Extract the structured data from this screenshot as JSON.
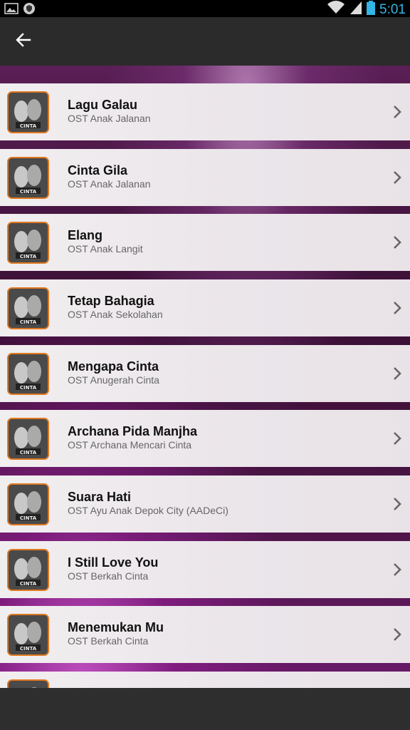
{
  "status_bar": {
    "time": "5:01",
    "left_icons": [
      "image-icon",
      "shield-icon"
    ],
    "right_icons": [
      "wifi-icon",
      "signal-icon",
      "battery-icon"
    ]
  },
  "app_bar": {
    "back_icon": "arrow-left-icon"
  },
  "colors": {
    "accent_time": "#33b5e5",
    "thumb_border": "#e07820",
    "item_bg": "#efebee"
  },
  "songs": [
    {
      "title": "Lagu Galau",
      "subtitle": "OST Anak Jalanan"
    },
    {
      "title": "Cinta Gila",
      "subtitle": "OST Anak Jalanan"
    },
    {
      "title": "Elang",
      "subtitle": "OST Anak Langit"
    },
    {
      "title": "Tetap Bahagia",
      "subtitle": "OST Anak Sekolahan"
    },
    {
      "title": "Mengapa Cinta",
      "subtitle": "OST Anugerah Cinta"
    },
    {
      "title": "Archana Pida Manjha",
      "subtitle": "OST Archana Mencari Cinta"
    },
    {
      "title": "Suara Hati",
      "subtitle": "OST Ayu Anak Depok City (AADeCi)"
    },
    {
      "title": "I Still Love You",
      "subtitle": "OST Berkah Cinta"
    },
    {
      "title": "Menemukan Mu",
      "subtitle": "OST Berkah Cinta"
    },
    {
      "title": "",
      "subtitle": ""
    }
  ],
  "thumb_caption": "CINTA"
}
